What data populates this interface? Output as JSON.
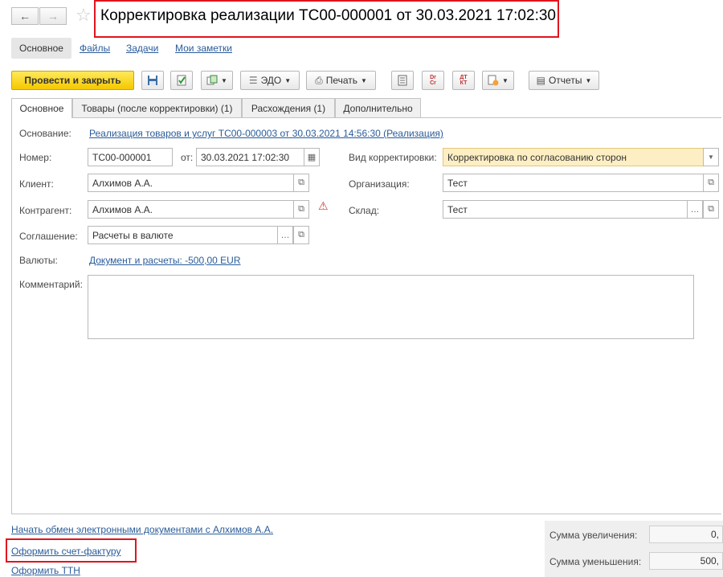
{
  "window": {
    "title": "Корректировка реализации ТС00-000001 от 30.03.2021 17:02:30"
  },
  "nav_menu": {
    "items": [
      "Основное",
      "Файлы",
      "Задачи",
      "Мои заметки"
    ]
  },
  "toolbar": {
    "post_close_label": "Провести и закрыть",
    "edo_label": "ЭДО",
    "print_label": "Печать",
    "reports_label": "Отчеты",
    "dr_cr_text": "Dr Cr",
    "dt_kt_text": "ДТ КТ"
  },
  "tabs": [
    "Основное",
    "Товары (после корректировки) (1)",
    "Расхождения (1)",
    "Дополнительно"
  ],
  "form": {
    "basis_label": "Основание:",
    "basis_value": "Реализация товаров и услуг ТС00-000003 от 30.03.2021 14:56:30 (Реализация)",
    "number_label": "Номер:",
    "number_value": "ТС00-000001",
    "from_label": "от:",
    "date_value": "30.03.2021 17:02:30",
    "correction_type_label": "Вид корректировки:",
    "correction_type_value": "Корректировка по согласованию сторон",
    "client_label": "Клиент:",
    "client_value": "Алхимов А.А.",
    "organization_label": "Организация:",
    "organization_value": "Тест",
    "counterparty_label": "Контрагент:",
    "counterparty_value": "Алхимов А.А.",
    "warehouse_label": "Склад:",
    "warehouse_value": "Тест",
    "agreement_label": "Соглашение:",
    "agreement_value": "Расчеты в валюте",
    "currencies_label": "Валюты:",
    "currencies_value": "Документ и расчеты: -500,00 EUR",
    "comment_label": "Комментарий:",
    "comment_value": ""
  },
  "footer": {
    "edo_link": "Начать обмен электронными документами с Алхимов А.А.",
    "invoice_link": "Оформить счет-фактуру",
    "ttn_link": "Оформить ТТН",
    "sum_increase_label": "Сумма увеличения:",
    "sum_increase_value": "0,",
    "sum_decrease_label": "Сумма уменьшения:",
    "sum_decrease_value": "500,"
  },
  "colors": {
    "accent_yellow": "#f5c800",
    "highlight_red": "#e0141e",
    "link_blue": "#2a5c9a"
  }
}
